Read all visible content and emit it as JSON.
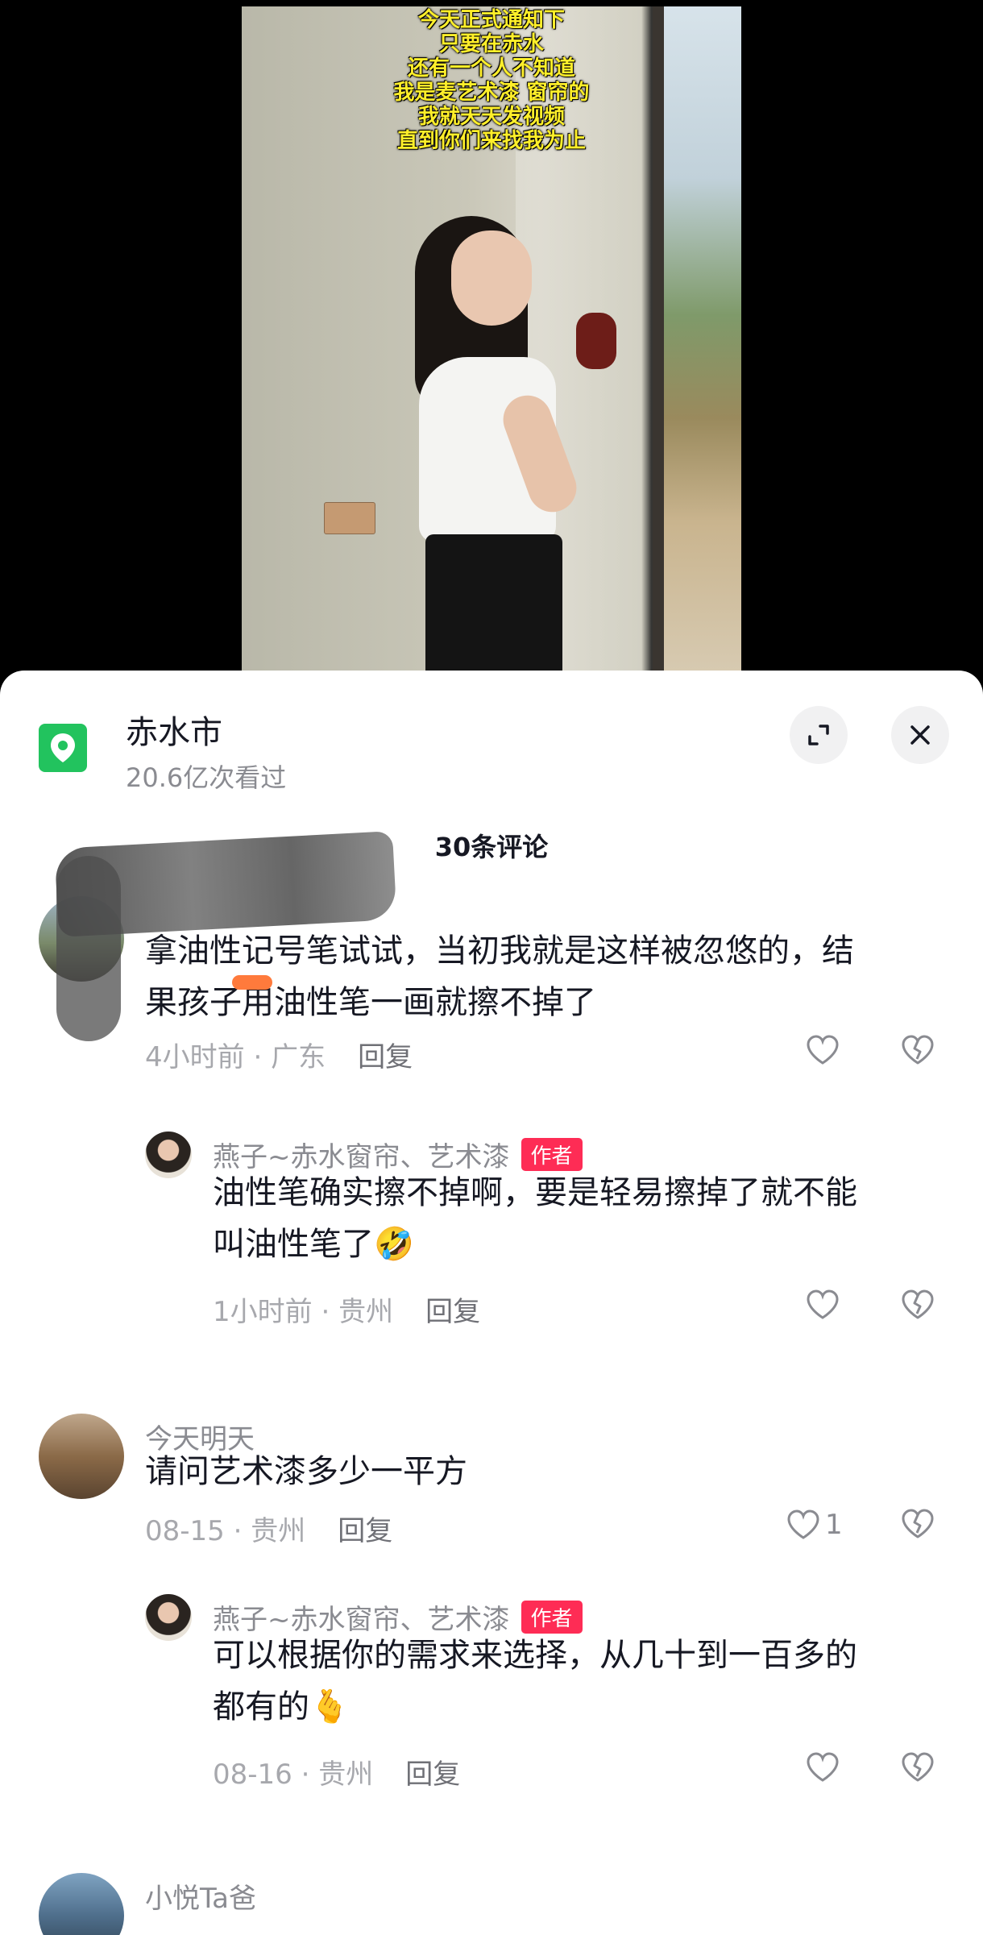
{
  "video": {
    "overlay_lines": [
      "今天正式通知下",
      "只要在赤水",
      "还有一个人不知道",
      "我是麦艺术漆 窗帘的",
      "我就天天发视频",
      "直到你们来找我为止"
    ]
  },
  "location": {
    "title": "赤水市",
    "views": "20.6亿次看过",
    "icon": "map-pin-icon"
  },
  "comments_header": "30条评论",
  "comments": [
    {
      "name": "",
      "text_line1": "拿油性记号笔试试，当初我就是这样被忽悠的，结",
      "text_line2": "果孩子用油性笔一画就擦不掉了",
      "time": "4小时前",
      "region": "广东",
      "reply": "回复",
      "likes": ""
    },
    {
      "name": "燕子~赤水窗帘、艺术漆",
      "tag": "作者",
      "text_line1": "油性笔确实擦不掉啊，要是轻易擦掉了就不能",
      "text_line2": "叫油性笔了🤣",
      "time": "1小时前",
      "region": "贵州",
      "reply": "回复",
      "likes": ""
    },
    {
      "name": "今天明天",
      "text_line1": "请问艺术漆多少一平方",
      "time": "08-15",
      "region": "贵州",
      "reply": "回复",
      "likes": "1"
    },
    {
      "name": "燕子~赤水窗帘、艺术漆",
      "tag": "作者",
      "text_line1": "可以根据你的需求来选择，从几十到一百多的",
      "text_line2": "都有的🫰",
      "time": "08-16",
      "region": "贵州",
      "reply": "回复",
      "likes": ""
    },
    {
      "name": "小悦Ta爸"
    }
  ],
  "colors": {
    "accent_green": "#22c35e",
    "author_tag": "#fe2c55",
    "overlay_text": "#ffef2a"
  }
}
